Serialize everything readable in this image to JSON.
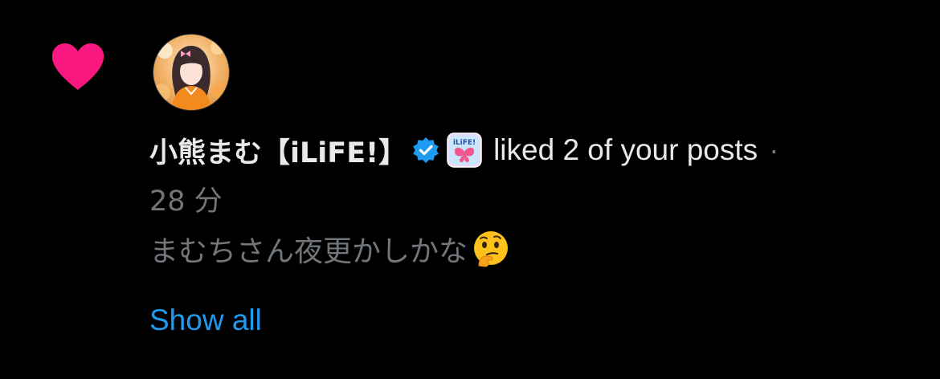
{
  "notification": {
    "icon": "heart-icon",
    "icon_color": "#f91880",
    "user_name": "小熊まむ【iLiFE!】",
    "verified_icon": "verified-badge-icon",
    "verified_color": "#1d9bf0",
    "affiliate_badge": "ilife-affiliate-badge",
    "action_text": "liked 2 of your posts",
    "separator": "·",
    "time": "28 分",
    "post_text": "まむちさん夜更かしかな",
    "post_emoji": "thinking-face-emoji",
    "show_all_label": "Show all",
    "link_color": "#1d9bf0",
    "secondary_text_color": "#71767b"
  }
}
